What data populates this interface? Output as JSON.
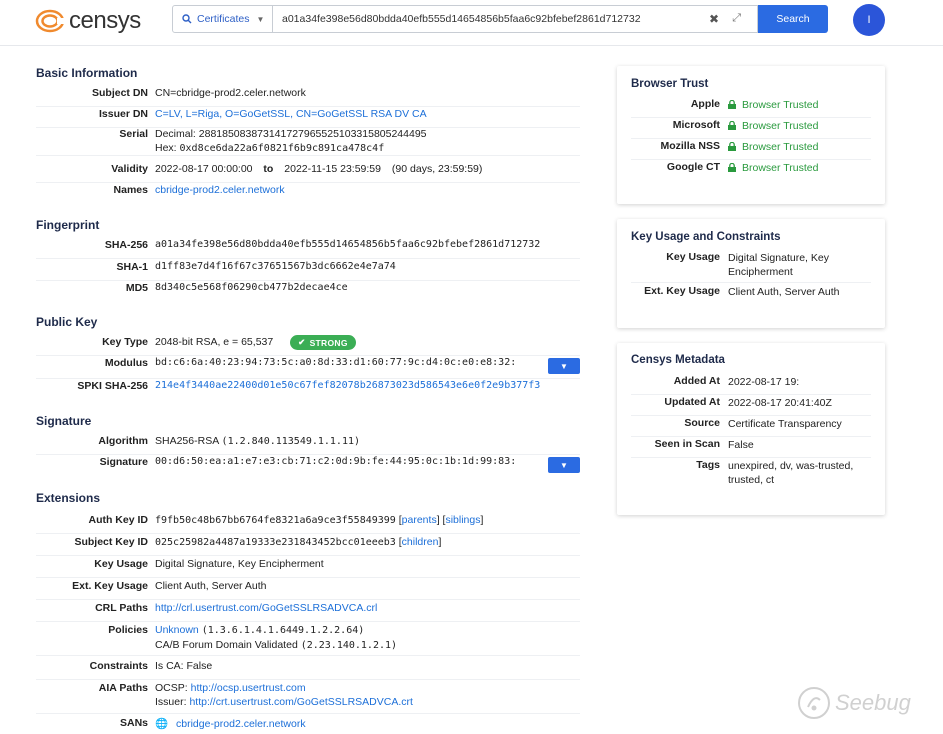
{
  "brand": {
    "name": "censys",
    "logo_color": "#f08a2e",
    "accent": "#2b6be2"
  },
  "search": {
    "type_label": "Certificates",
    "query": "a01a34fe398e56d80bdda40efb555d14654856b5faa6c92bfebef2861d712732",
    "button_label": "Search"
  },
  "user": {
    "initial": "I"
  },
  "basic": {
    "title": "Basic Information",
    "subject_dn_label": "Subject DN",
    "subject_dn": "CN=cbridge-prod2.celer.network",
    "issuer_dn_label": "Issuer DN",
    "issuer_dn": "C=LV, L=Riga, O=GoGetSSL, CN=GoGetSSL RSA DV CA",
    "serial_label": "Serial",
    "serial_decimal": "Decimal: 288185083873141727965525103315805244495",
    "serial_hex_prefix": "Hex:",
    "serial_hex": "0xd8ce6da22a6f0821f6b9c891ca478c4f",
    "validity_label": "Validity",
    "validity_start": "2022-08-17 00:00:00",
    "validity_to": "to",
    "validity_end": "2022-11-15 23:59:59",
    "validity_duration": "(90 days, 23:59:59)",
    "names_label": "Names",
    "names": "cbridge-prod2.celer.network"
  },
  "fingerprint": {
    "title": "Fingerprint",
    "sha256_label": "SHA-256",
    "sha256": "a01a34fe398e56d80bdda40efb555d14654856b5faa6c92bfebef2861d712732",
    "sha1_label": "SHA-1",
    "sha1": "d1ff83e7d4f16f67c37651567b3dc6662e4e7a74",
    "md5_label": "MD5",
    "md5": "8d340c5e568f06290cb477b2decae4ce"
  },
  "public_key": {
    "title": "Public Key",
    "key_type_label": "Key Type",
    "key_type": "2048-bit RSA, e = 65,537",
    "strength_badge": "STRONG",
    "modulus_label": "Modulus",
    "modulus": "bd:c6:6a:40:23:94:73:5c:a0:8d:33:d1:60:77:9c:d4:0c:e0:e8:32:",
    "spki_label": "SPKI SHA-256",
    "spki": "214e4f3440ae22400d01e50c67fef82078b26873023d586543e6e0f2e9b377f3"
  },
  "signature": {
    "title": "Signature",
    "algorithm_label": "Algorithm",
    "algorithm": "SHA256-RSA",
    "algorithm_oid": "(1.2.840.113549.1.1.11)",
    "signature_label": "Signature",
    "signature": "00:d6:50:ea:a1:e7:e3:cb:71:c2:0d:9b:fe:44:95:0c:1b:1d:99:83:"
  },
  "extensions": {
    "title": "Extensions",
    "auth_key_id_label": "Auth Key ID",
    "auth_key_id": "f9fb50c48b67bb6764fe8321a6a9ce3f55849399",
    "parents_link": "parents",
    "siblings_link": "siblings",
    "subject_key_id_label": "Subject Key ID",
    "subject_key_id": "025c25982a4487a19333e231843452bcc01eeeb3",
    "children_link": "children",
    "key_usage_label": "Key Usage",
    "key_usage": "Digital Signature, Key Encipherment",
    "ext_key_usage_label": "Ext. Key Usage",
    "ext_key_usage": "Client Auth, Server Auth",
    "crl_paths_label": "CRL Paths",
    "crl_path": "http://crl.usertrust.com/GoGetSSLRSADVCA.crl",
    "policies_label": "Policies",
    "policy_unknown": "Unknown",
    "policy_unknown_oid": "(1.3.6.1.4.1.6449.1.2.2.64)",
    "policy_cab": "CA/B Forum Domain Validated",
    "policy_cab_oid": "(2.23.140.1.2.1)",
    "constraints_label": "Constraints",
    "constraints": "Is CA: False",
    "aia_label": "AIA Paths",
    "aia_ocsp_prefix": "OCSP:",
    "aia_ocsp": "http://ocsp.usertrust.com",
    "aia_issuer_prefix": "Issuer:",
    "aia_issuer": "http://crt.usertrust.com/GoGetSSLRSADVCA.crt",
    "sans_label": "SANs",
    "san": "cbridge-prod2.celer.network"
  },
  "browser_trust": {
    "title": "Browser Trust",
    "items": [
      {
        "name": "Apple",
        "status": "Browser Trusted"
      },
      {
        "name": "Microsoft",
        "status": "Browser Trusted"
      },
      {
        "name": "Mozilla NSS",
        "status": "Browser Trusted"
      },
      {
        "name": "Google CT",
        "status": "Browser Trusted"
      }
    ]
  },
  "key_usage_card": {
    "title": "Key Usage and Constraints",
    "key_usage_label": "Key Usage",
    "key_usage": "Digital Signature, Key Encipherment",
    "ext_key_usage_label": "Ext. Key Usage",
    "ext_key_usage": "Client Auth, Server Auth"
  },
  "metadata": {
    "title": "Censys Metadata",
    "added_at_label": "Added At",
    "added_at": "2022-08-17 19:",
    "updated_at_label": "Updated At",
    "updated_at": "2022-08-17 20:41:40Z",
    "source_label": "Source",
    "source": "Certificate Transparency",
    "seen_label": "Seen in Scan",
    "seen": "False",
    "tags_label": "Tags",
    "tags": "unexpired, dv, was-trusted, trusted, ct"
  },
  "watermark": {
    "text": "Seebug"
  }
}
